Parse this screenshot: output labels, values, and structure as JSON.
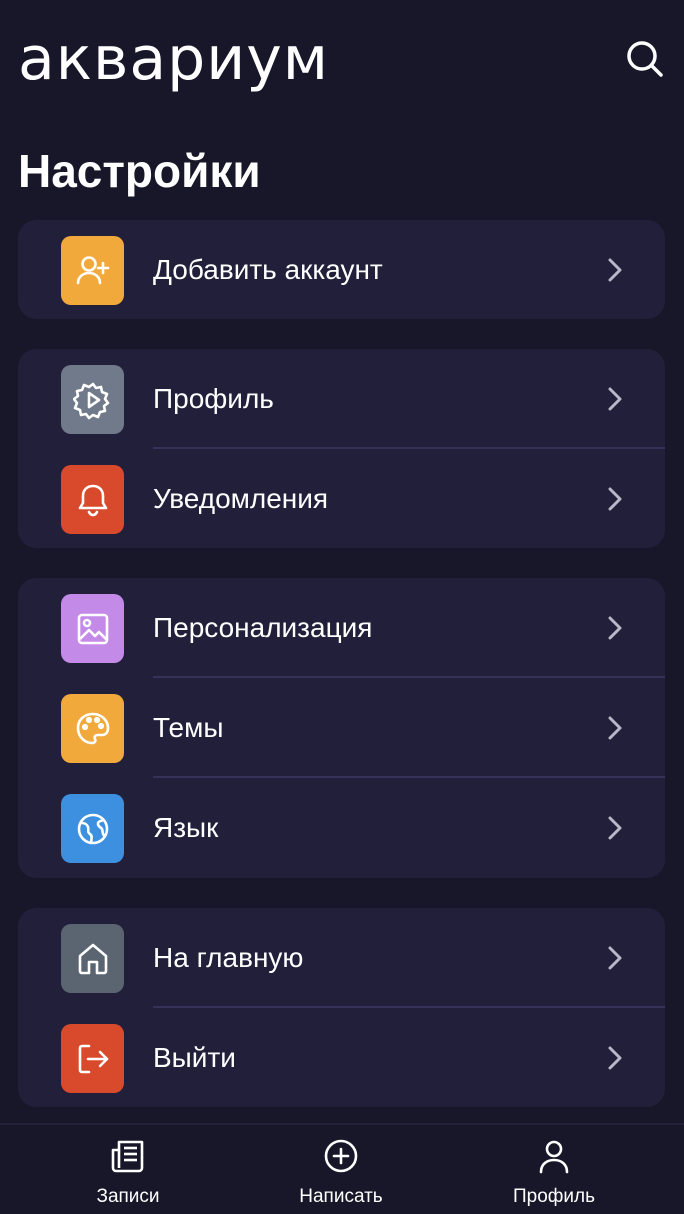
{
  "app": {
    "logo_text": "аквариум"
  },
  "page": {
    "title": "Настройки"
  },
  "groups": [
    {
      "items": [
        {
          "label": "Добавить аккаунт",
          "icon": "add-user-icon",
          "color": "#f2a93b"
        }
      ]
    },
    {
      "items": [
        {
          "label": "Профиль",
          "icon": "gear-icon",
          "color": "#707a8a"
        },
        {
          "label": "Уведомления",
          "icon": "bell-icon",
          "color": "#d84a2b"
        }
      ]
    },
    {
      "items": [
        {
          "label": "Персонализация",
          "icon": "image-icon",
          "color": "#c48ae8"
        },
        {
          "label": "Темы",
          "icon": "palette-icon",
          "color": "#f2a93b"
        },
        {
          "label": "Язык",
          "icon": "globe-icon",
          "color": "#3d8fe0"
        }
      ]
    },
    {
      "items": [
        {
          "label": "На главную",
          "icon": "home-icon",
          "color": "#5b6572"
        },
        {
          "label": "Выйти",
          "icon": "logout-icon",
          "color": "#d84a2b"
        }
      ]
    }
  ],
  "tabbar": {
    "tabs": [
      {
        "label": "Записи",
        "icon": "newspaper-icon"
      },
      {
        "label": "Написать",
        "icon": "plus-circle-icon"
      },
      {
        "label": "Профиль",
        "icon": "user-icon"
      }
    ]
  },
  "colors": {
    "background": "#181729",
    "card": "#211f3a",
    "separator": "#35325a",
    "chevron": "#b9b7c8"
  }
}
